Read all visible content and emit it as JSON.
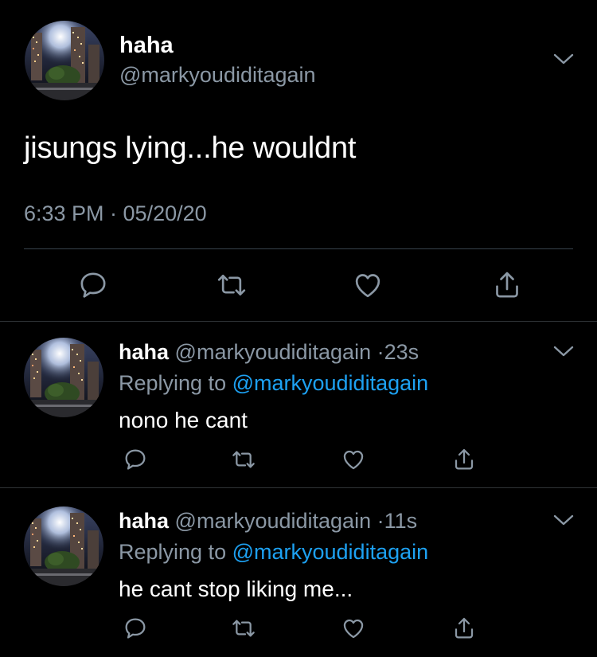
{
  "colors": {
    "background": "#000000",
    "primary_text": "#ffffff",
    "secondary_text": "#8b98a5",
    "link": "#1da1f2",
    "divider": "#2f3336"
  },
  "main_tweet": {
    "display_name": "haha",
    "handle": "@markyoudiditagain",
    "text": "jisungs lying...he wouldnt",
    "timestamp": "6:33 PM · 05/20/20",
    "avatar": "night-city-photo",
    "actions": [
      "reply-icon",
      "retweet-icon",
      "like-icon",
      "share-icon"
    ]
  },
  "replies": [
    {
      "display_name": "haha",
      "handle": "@markyoudiditagain",
      "dot": "·",
      "time": "23s",
      "replying_prefix": "Replying to ",
      "replying_to": "@markyoudiditagain",
      "text": "nono he cant",
      "avatar": "night-city-photo"
    },
    {
      "display_name": "haha",
      "handle": "@markyoudiditagain",
      "dot": "·",
      "time": "11s",
      "replying_prefix": "Replying to ",
      "replying_to": "@markyoudiditagain",
      "text": "he cant stop liking me...",
      "avatar": "night-city-photo"
    }
  ]
}
